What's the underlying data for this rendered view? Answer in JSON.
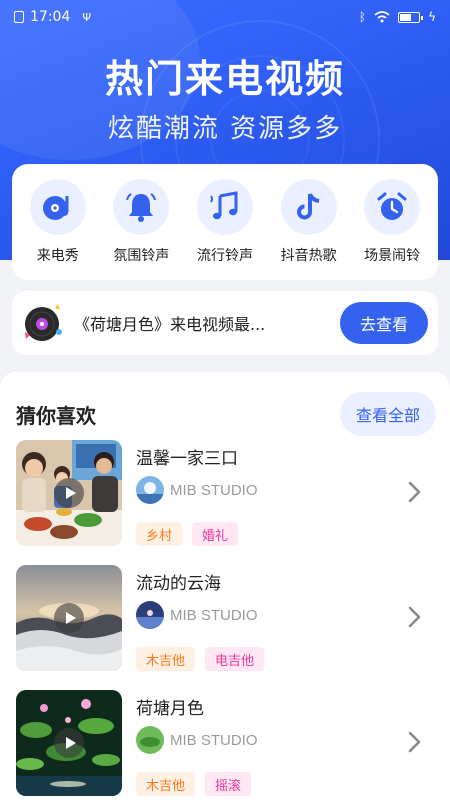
{
  "status": {
    "time": "17:04"
  },
  "hero": {
    "title": "热门来电视频",
    "subtitle": "炫酷潮流  资源多多"
  },
  "categories": [
    {
      "label": "来电秀",
      "icon": "vinyl-music-icon"
    },
    {
      "label": "氛围铃声",
      "icon": "bell-icon"
    },
    {
      "label": "流行铃声",
      "icon": "music-notes-icon"
    },
    {
      "label": "抖音热歌",
      "icon": "tiktok-note-icon"
    },
    {
      "label": "场景闹铃",
      "icon": "alarm-clock-icon"
    }
  ],
  "promo": {
    "text": "《荷塘月色》来电视频最...",
    "button": "去查看"
  },
  "recommend": {
    "title": "猜你喜欢",
    "view_all": "查看全部",
    "items": [
      {
        "title": "温馨一家三口",
        "author": "MIB STUDIO",
        "tags": [
          "乡村",
          "婚礼"
        ],
        "tag_colors": [
          "orange",
          "pink"
        ]
      },
      {
        "title": "流动的云海",
        "author": "MIB STUDIO",
        "tags": [
          "木吉他",
          "电吉他"
        ],
        "tag_colors": [
          "orange",
          "pink"
        ]
      },
      {
        "title": "荷塘月色",
        "author": "MIB STUDIO",
        "tags": [
          "木吉他",
          "摇滚"
        ],
        "tag_colors": [
          "orange",
          "pink"
        ]
      }
    ]
  },
  "colors": {
    "primary": "#3561ef",
    "hero_blue": "#2f5ff5",
    "tag_orange": "#ff7a1a",
    "tag_pink": "#f0369d"
  },
  "battery_level": 0.6
}
